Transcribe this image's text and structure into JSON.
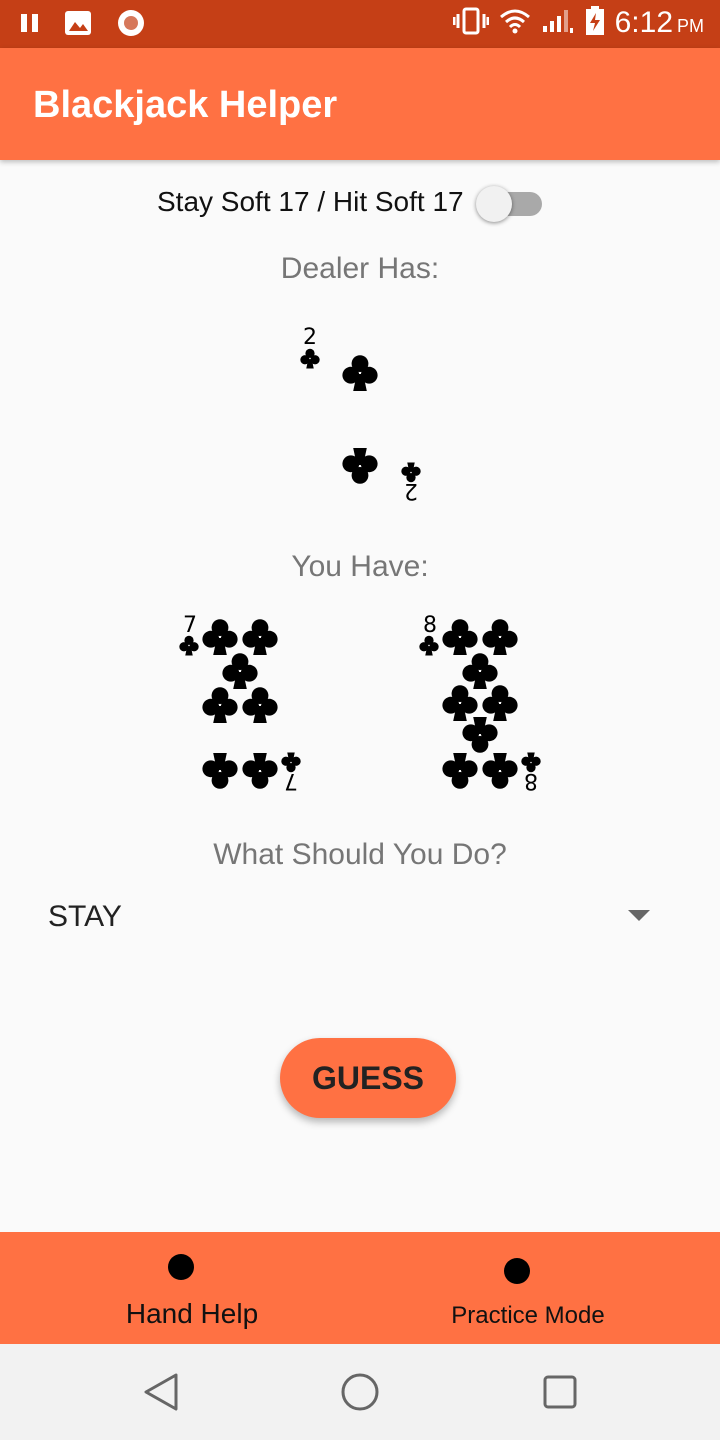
{
  "status_bar": {
    "time": "6:12",
    "ampm": "PM",
    "icons": [
      "pause-icon",
      "image-icon",
      "record-icon",
      "vibrate-icon",
      "wifi-icon",
      "signal-icon",
      "battery-charging-icon"
    ]
  },
  "app_bar": {
    "title": "Blackjack Helper"
  },
  "soft17": {
    "label": "Stay Soft 17 / Hit Soft 17",
    "enabled": false
  },
  "dealer": {
    "label": "Dealer Has:",
    "card": {
      "rank": "2",
      "suit": "clubs"
    }
  },
  "player": {
    "label": "You Have:",
    "cards": [
      {
        "rank": "7",
        "suit": "clubs"
      },
      {
        "rank": "8",
        "suit": "clubs"
      }
    ]
  },
  "question": {
    "label": "What Should You Do?"
  },
  "action_select": {
    "value": "STAY"
  },
  "guess_button": {
    "label": "GUESS"
  },
  "bottom_nav": {
    "items": [
      {
        "label": "Hand Help"
      },
      {
        "label": "Practice Mode"
      }
    ]
  },
  "colors": {
    "status_bar": "#c53f16",
    "primary": "#ff7143",
    "background": "#fafafa"
  },
  "system_nav": {
    "icons": [
      "back-icon",
      "home-icon",
      "recents-icon"
    ]
  }
}
